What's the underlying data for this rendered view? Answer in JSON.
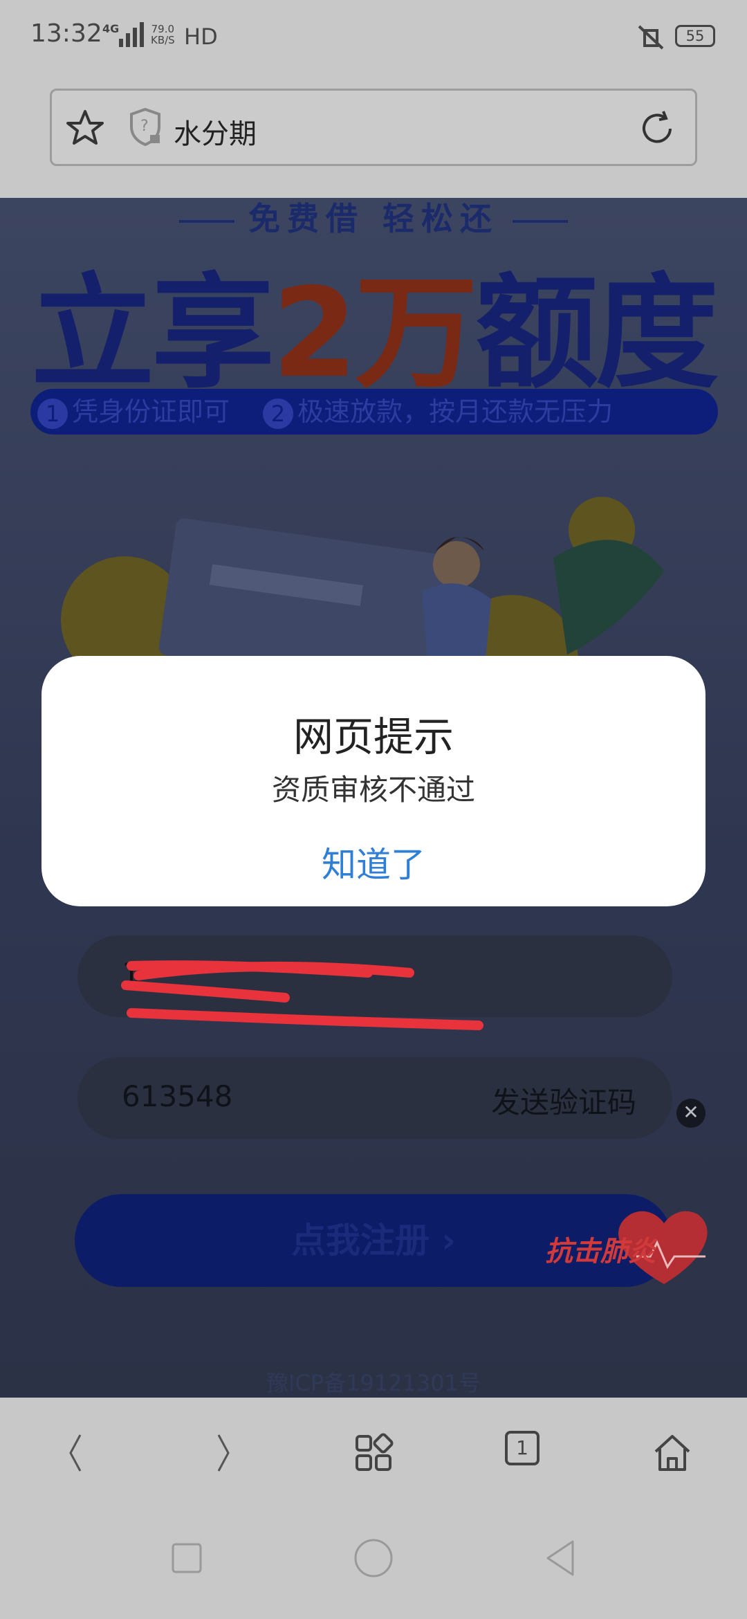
{
  "status_bar": {
    "time": "13:32",
    "network": "4G",
    "speed_value": "79.0",
    "speed_unit": "KB/S",
    "hd": "HD",
    "battery": "55",
    "icons": [
      "signal-icon",
      "mute-icon",
      "battery-icon"
    ]
  },
  "address_bar": {
    "title": "水分期",
    "icons": [
      "star-icon",
      "shield-icon",
      "reload-icon"
    ]
  },
  "page": {
    "slogan_top": "免费借 轻松还",
    "headline_part1": "立享",
    "headline_highlight": "2万",
    "headline_part2": "额度",
    "feature1_num": "1",
    "feature1": "凭身份证即可",
    "feature2_num": "2",
    "feature2": "极速放款，按月还款无压力",
    "phone_value": "1",
    "code_value": "613548",
    "send_code_label": "发送验证码",
    "register_label": "点我注册 ›",
    "badge_label": "抗击肺炎",
    "icp": "豫ICP备19121301号"
  },
  "dialog": {
    "title": "网页提示",
    "message": "资质审核不通过",
    "button": "知道了"
  },
  "toolbar": {
    "tab_count": "1",
    "icons": [
      "back-icon",
      "forward-icon",
      "menu-grid-icon",
      "tabs-icon",
      "home-icon"
    ]
  },
  "system_nav": {
    "icons": [
      "recents-icon",
      "home-circle-icon",
      "back-triangle-icon"
    ]
  },
  "colors": {
    "dialog_button": "#2f7fd6",
    "headline_highlight": "#7a2a14",
    "scribble": "#e8323c"
  }
}
